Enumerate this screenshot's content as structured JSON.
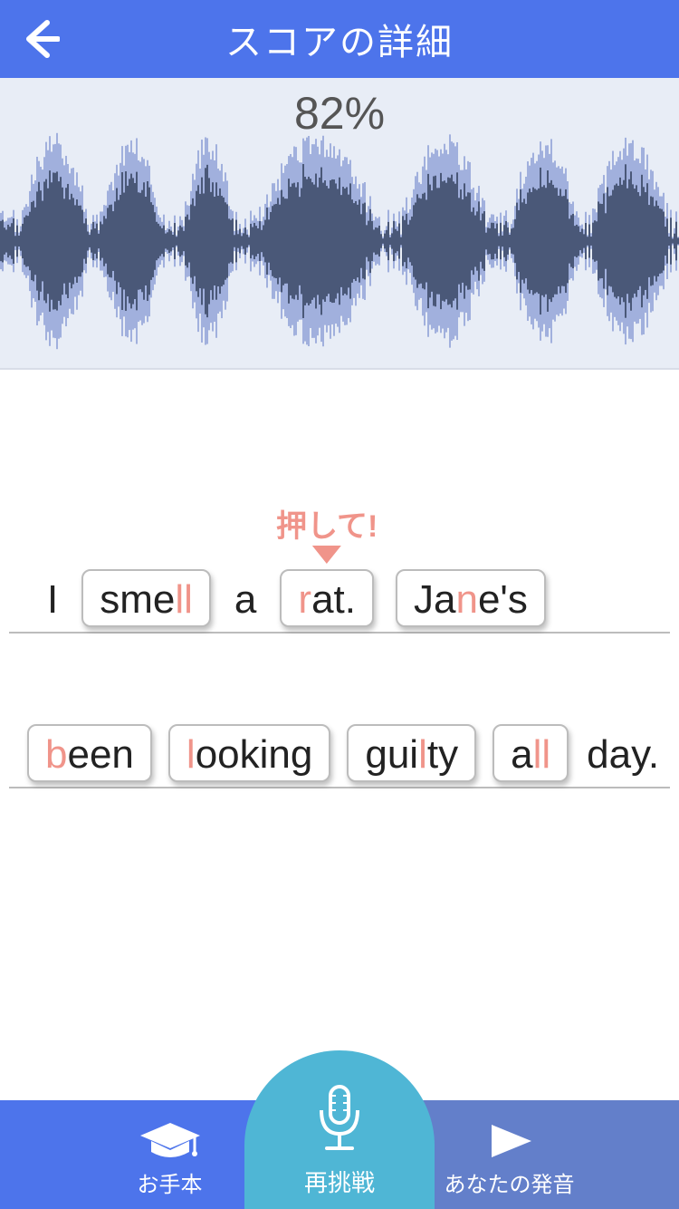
{
  "header": {
    "title": "スコアの詳細"
  },
  "score": {
    "percent": "82%"
  },
  "hint": {
    "text": "押して!"
  },
  "words": {
    "line1": {
      "w0": "I",
      "w1_pre": "sme",
      "w1_hl": "ll",
      "w2": "a",
      "w3_hl": "r",
      "w3_post": "at.",
      "w4_pre": "Ja",
      "w4_hl": "n",
      "w4_post": "e's"
    },
    "line2": {
      "w0_hl": "b",
      "w0_post": "een",
      "w1_hl": "l",
      "w1_post": "ooking",
      "w2_pre": "gui",
      "w2_hl": "l",
      "w2_post": "ty",
      "w3_pre": "a",
      "w3_hl": "ll",
      "w4": "day."
    }
  },
  "nav": {
    "left": "お手本",
    "center": "再挑戦",
    "right": "あなたの発音"
  }
}
